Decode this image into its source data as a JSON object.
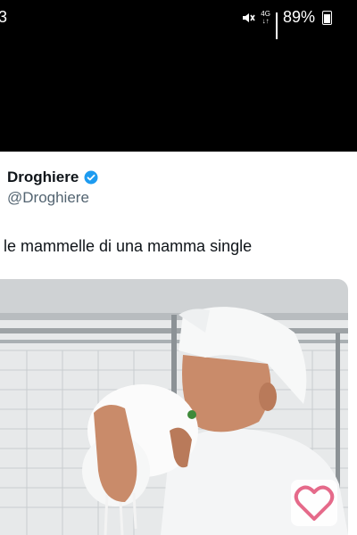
{
  "status": {
    "time_partial": "3",
    "network": "4G",
    "battery": "89%"
  },
  "tweet": {
    "author_name": "Droghiere",
    "author_handle": "@Droghiere",
    "text": "le mammelle di una mamma single",
    "verified": true
  },
  "media": {
    "icon": "heart-icon"
  }
}
